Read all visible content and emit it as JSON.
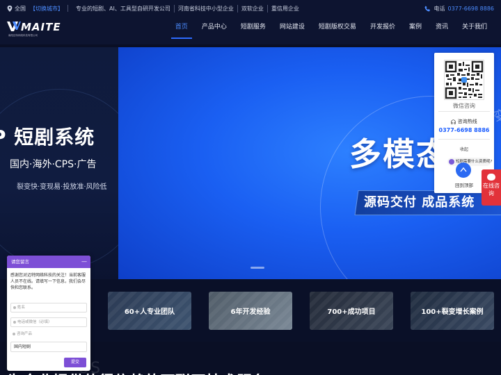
{
  "topbar": {
    "region": "全国",
    "switch_city": "【切换城市】",
    "tags": [
      "专业的短剧、AI、工具型自研开发公司",
      "河南省科技中小型企业",
      "双软企业",
      "重信用企业"
    ],
    "phone_label": "电话",
    "phone_number": "0377-6698 8886"
  },
  "logo": {
    "name": "MAITE",
    "sub": "南阳迈特网络科技有限公司"
  },
  "nav": {
    "items": [
      "首页",
      "产品中心",
      "短剧服务",
      "网站建设",
      "短剧版权交易",
      "开发报价",
      "案例",
      "资讯",
      "关于我们"
    ],
    "active_index": 0
  },
  "hero": {
    "left_title": "P 短剧系统",
    "left_line2": "国内·海外·CPS·广告",
    "left_line3": "裂变快·变现易·投放准·风险低",
    "right_big": "多模态",
    "right_badge": "源码交付 成品系统",
    "right_deco": "变"
  },
  "features": [
    "60+人专业团队",
    "6年开发经验",
    "700+成功项目",
    "100+裂变增长案例"
  ],
  "bottom": {
    "ghost": "US",
    "headline": "为企业提供值得信赖的互联网技术服务"
  },
  "side_panel": {
    "qr_label": "微信咨询",
    "hotline_label": "咨询热线",
    "hotline_number": "0377-6698 8886",
    "collapse": "收起",
    "chat_prompt": "短剧需要什么资质呢?",
    "back_to_top": "回到顶部"
  },
  "online_consult": "在线咨询",
  "message_form": {
    "title": "请您留言",
    "minimize": "—",
    "message": "感谢您对迈特网络科技的关注！当前客服人员不在线。请填写一下信息，我们会尽快和您联系。",
    "name_placeholder": "姓名",
    "phone_placeholder": "电话或微信（必填）",
    "product_label": "咨询产品",
    "product_value": "国内短剧",
    "submit": "提交"
  },
  "colors": {
    "accent": "#1a5cff",
    "form": "#7d4fd6",
    "online": "#e2323a"
  }
}
